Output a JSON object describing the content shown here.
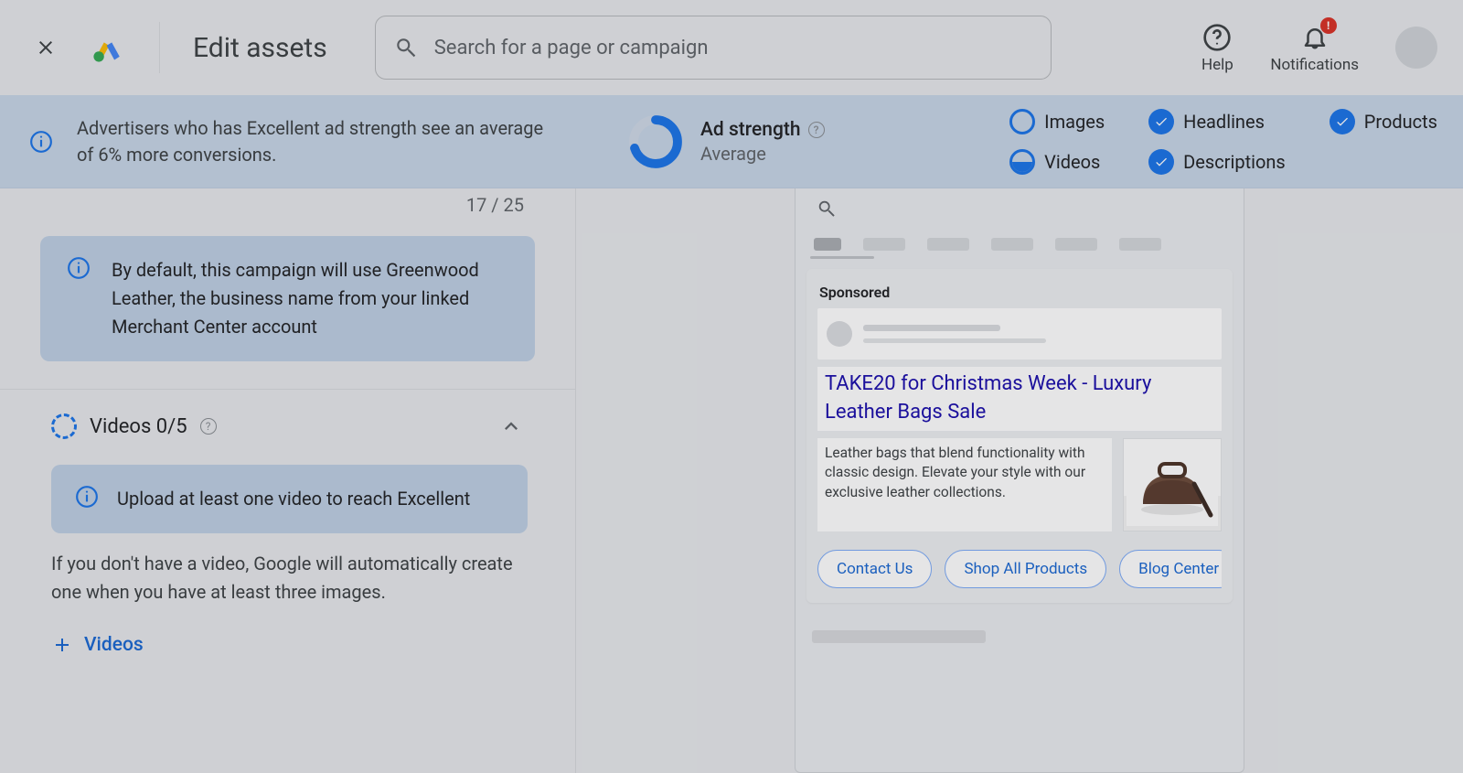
{
  "header": {
    "title": "Edit assets",
    "search_placeholder": "Search for a page or campaign",
    "help_label": "Help",
    "notifications_label": "Notifications",
    "notification_alert": "!"
  },
  "banner": {
    "message": "Advertisers who has Excellent ad strength see an average of 6% more conversions.",
    "strength_title": "Ad strength",
    "strength_value": "Average",
    "checks": {
      "images": "Images",
      "videos": "Videos",
      "headlines": "Headlines",
      "descriptions": "Descriptions",
      "products": "Products"
    }
  },
  "left": {
    "counter": "17 / 25",
    "info": "By default, this campaign will use Greenwood Leather, the business name from your linked Merchant Center account",
    "videos": {
      "title": "Videos 0/5",
      "hint": "Upload at least one video to reach Excellent",
      "desc": "If you don't have a video, Google will automatically create one when you have at least three images.",
      "add": "Videos"
    }
  },
  "preview": {
    "sponsored": "Sponsored",
    "headline": "TAKE20 for Christmas Week - Luxury Leather Bags Sale",
    "description": "Leather bags that blend functionality with classic design. Elevate your style with our exclusive leather collections.",
    "chips": [
      "Contact Us",
      "Shop All Products",
      "Blog Center"
    ]
  }
}
